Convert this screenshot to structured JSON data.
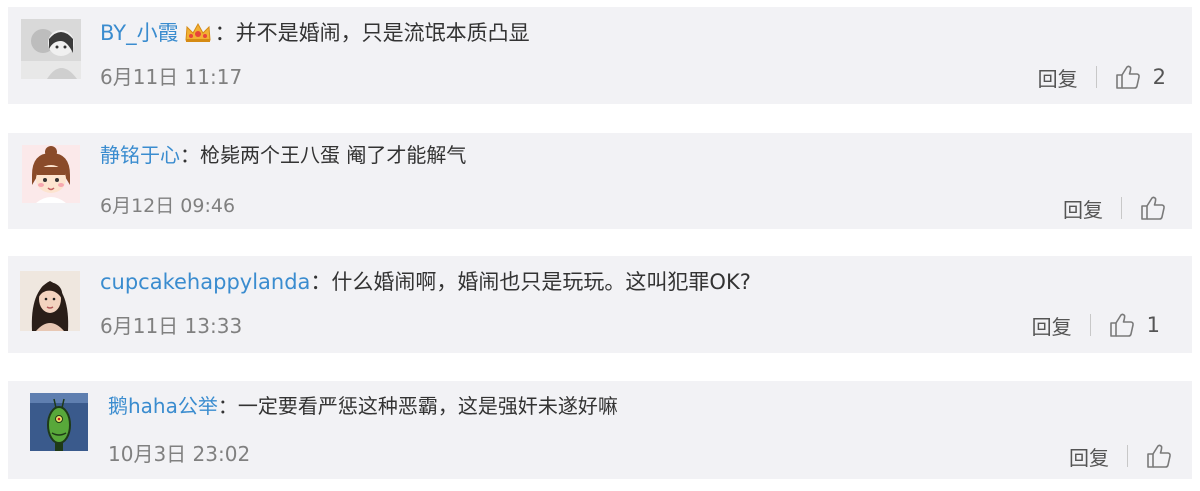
{
  "comments": [
    {
      "username": "BY_小霞",
      "has_badge": true,
      "separator": "：",
      "text": "并不是婚闹，只是流氓本质凸显",
      "timestamp": "6月11日 11:17",
      "reply_label": "回复",
      "like_count": "2"
    },
    {
      "username": "静铭于心",
      "has_badge": false,
      "separator": "：",
      "text": "枪毙两个王八蛋 阉了才能解气",
      "timestamp": "6月12日 09:46",
      "reply_label": "回复",
      "like_count": ""
    },
    {
      "username": "cupcakehappylanda",
      "has_badge": false,
      "separator": "：",
      "text": "什么婚闹啊，婚闹也只是玩玩。这叫犯罪OK?",
      "timestamp": "6月11日 13:33",
      "reply_label": "回复",
      "like_count": "1"
    },
    {
      "username": "鹅haha公举",
      "has_badge": false,
      "separator": "：",
      "text": "一定要看严惩这种恶霸，这是强奸未遂好嘛",
      "timestamp": "10月3日 23:02",
      "reply_label": "回复",
      "like_count": ""
    }
  ],
  "icons": {
    "like": "thumbs-up-outline-icon",
    "badge": "crown-badge-icon"
  },
  "colors": {
    "username": "#3a8ccf",
    "card_bg": "#f2f2f5",
    "meta_text": "#808080"
  }
}
